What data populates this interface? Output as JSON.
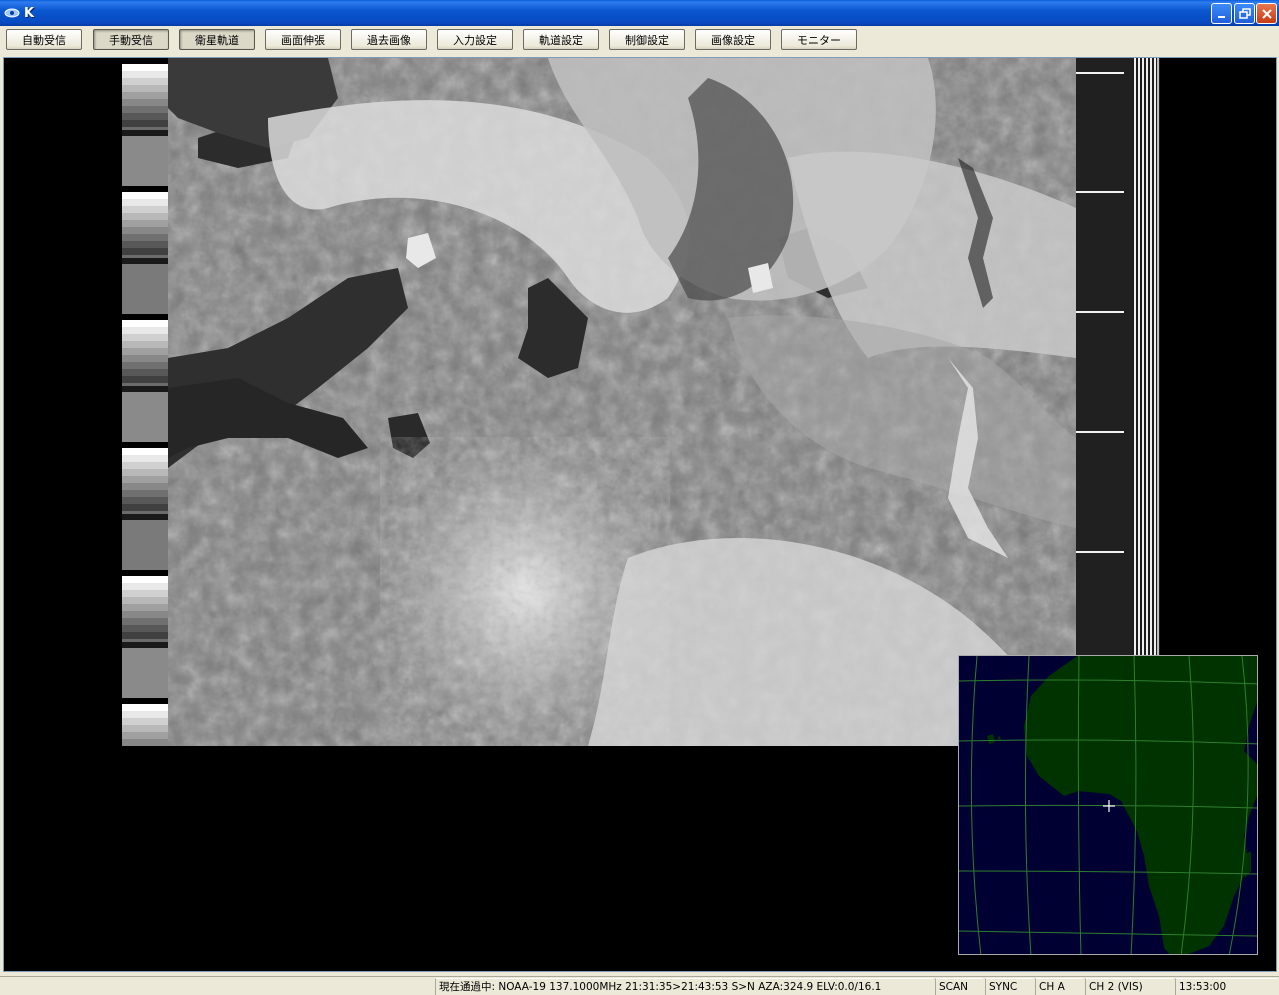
{
  "window": {
    "title": "K",
    "icon": "satellite-dish-icon",
    "minimize_icon": "minimize-icon",
    "maximize_icon": "restore-icon",
    "close_icon": "close-icon"
  },
  "toolbar": {
    "buttons": [
      {
        "label": "自動受信",
        "pressed": false
      },
      {
        "label": "手動受信",
        "pressed": true
      },
      {
        "label": "衛星軌道",
        "pressed": true
      },
      {
        "label": "画面伸張",
        "pressed": false
      },
      {
        "label": "過去画像",
        "pressed": false
      },
      {
        "label": "入力設定",
        "pressed": false
      },
      {
        "label": "軌道設定",
        "pressed": false
      },
      {
        "label": "制御設定",
        "pressed": false
      },
      {
        "label": "画像設定",
        "pressed": false
      },
      {
        "label": "モニター",
        "pressed": false
      }
    ]
  },
  "map": {
    "land_color": "#003300",
    "ocean_color": "#000033",
    "grid_color": "#2e7d2e",
    "marker_color": "#ffffff"
  },
  "statusbar": {
    "pass_info": "現在通過中: NOAA-19 137.1000MHz 21:31:35>21:43:53 S>N AZA:324.9 ELV:0.0/16.1",
    "scan": "SCAN",
    "sync": "SYNC",
    "channel_a": "CH A",
    "channel_b": "CH 2 (VIS)",
    "time": "13:53:00"
  }
}
